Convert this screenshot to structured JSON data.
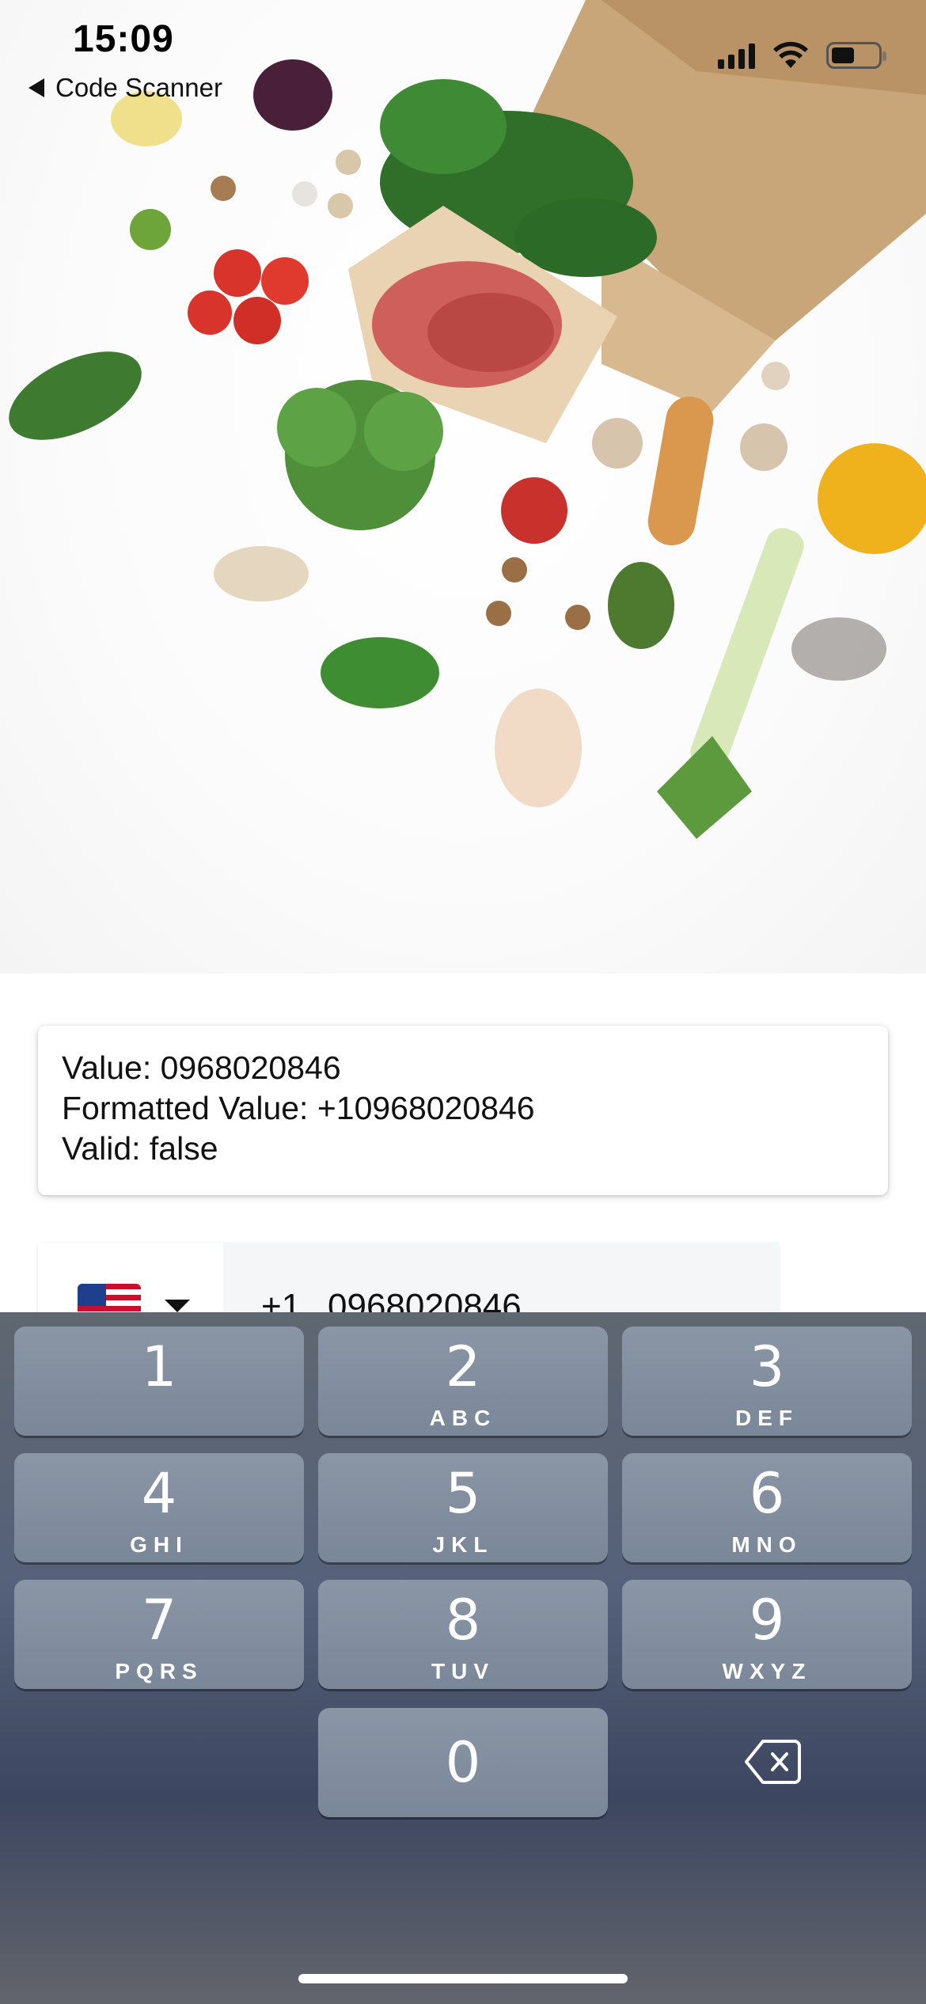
{
  "status_bar": {
    "time": "15:09",
    "back_label": "Code Scanner"
  },
  "result": {
    "value_line": "Value: 0968020846",
    "formatted_line": "Formatted Value: +10968020846",
    "valid_line": "Valid: false"
  },
  "phone_input": {
    "country_flag": "us-flag-icon",
    "dial_code": "+1",
    "value": "0968020846"
  },
  "keypad": {
    "keys": [
      {
        "num": "1",
        "letters": ""
      },
      {
        "num": "2",
        "letters": "ABC"
      },
      {
        "num": "3",
        "letters": "DEF"
      },
      {
        "num": "4",
        "letters": "GHI"
      },
      {
        "num": "5",
        "letters": "JKL"
      },
      {
        "num": "6",
        "letters": "MNO"
      },
      {
        "num": "7",
        "letters": "PQRS"
      },
      {
        "num": "8",
        "letters": "TUV"
      },
      {
        "num": "9",
        "letters": "WXYZ"
      },
      {
        "num": "0",
        "letters": ""
      }
    ],
    "delete_icon": "backspace-icon"
  },
  "colors": {
    "key_face": "#8a96a6",
    "keyboard_bg": "#55617a"
  }
}
